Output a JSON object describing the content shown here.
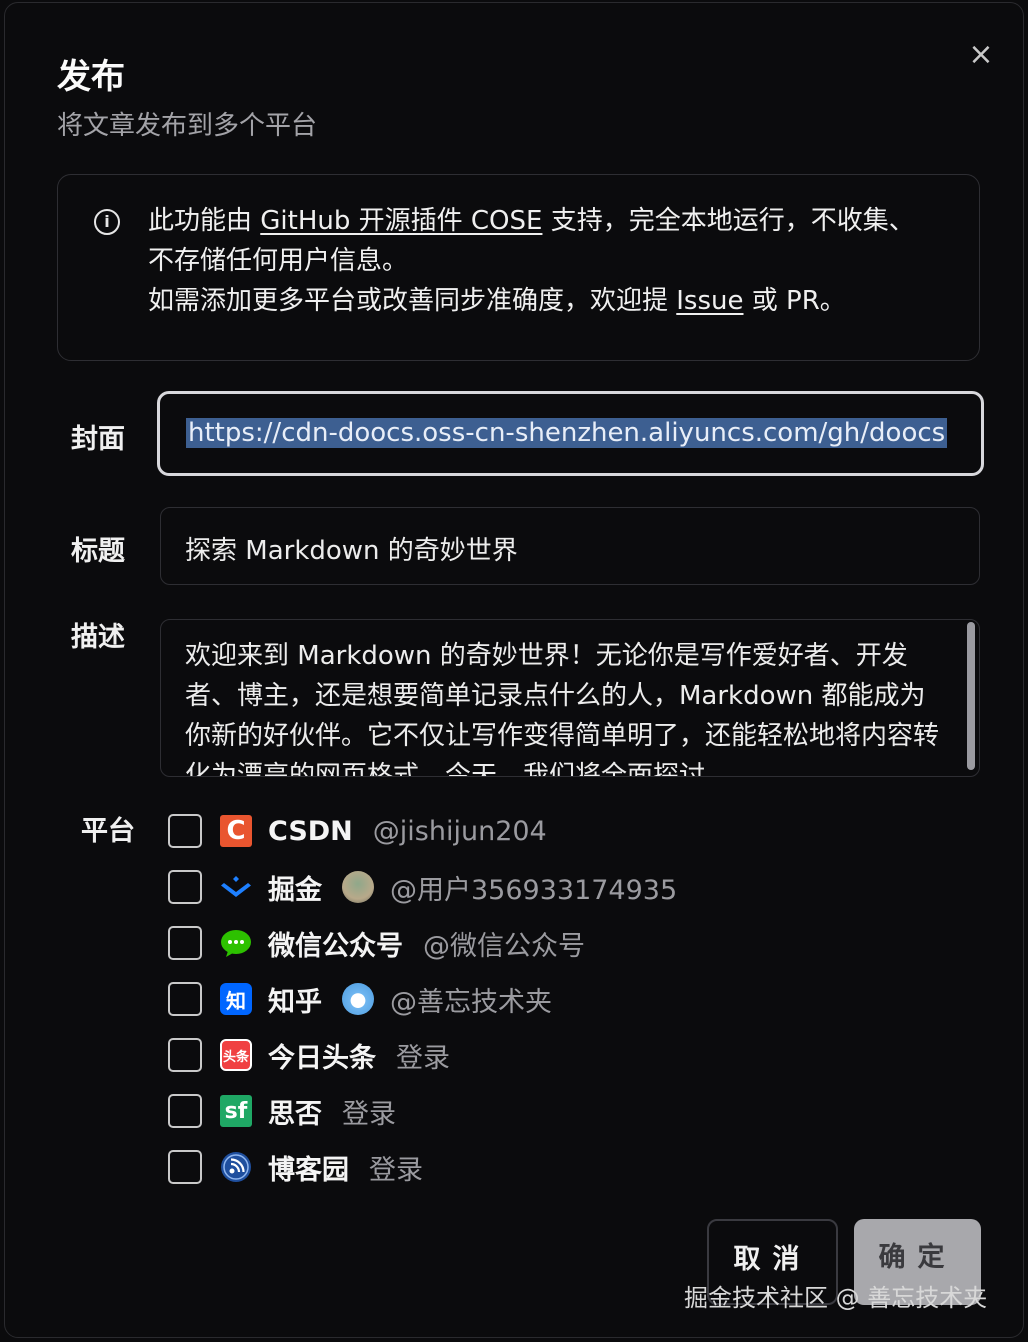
{
  "dialog": {
    "title": "发布",
    "subtitle": "将文章发布到多个平台",
    "close_symbol": "×"
  },
  "notice": {
    "icon": "info-icon",
    "part1": "此功能由 ",
    "link1": "GitHub 开源插件 COSE",
    "part2": " 支持，完全本地运行，不收集、不存储任何用户信息。",
    "part3": "如需添加更多平台或改善同步准确度，欢迎提 ",
    "link2": "Issue",
    "part4": " 或 PR。"
  },
  "form": {
    "cover_label": "封面",
    "cover_value": "https://cdn-doocs.oss-cn-shenzhen.aliyuncs.com/gh/doocs",
    "title_label": "标题",
    "title_value": "探索 Markdown 的奇妙世界",
    "desc_label": "描述",
    "desc_value": "欢迎来到 Markdown 的奇妙世界！无论你是写作爱好者、开发者、博主，还是想要简单记录点什么的人，Markdown 都能成为你新的好伙伴。它不仅让写作变得简单明了，还能轻松地将内容转化为漂亮的网页格式。今天，我们将全面探讨"
  },
  "platforms": {
    "label": "平台",
    "items": [
      {
        "name": "CSDN",
        "account": "@jishijun204",
        "icon": "csdn-icon",
        "icon_glyph": "C",
        "color": "#e9552f"
      },
      {
        "name": "掘金",
        "account": "@用户356933174935",
        "icon": "juejin-icon",
        "color": "#1e80ff"
      },
      {
        "name": "微信公众号",
        "account": "@微信公众号",
        "icon": "wechat-icon",
        "color": "#2dc100"
      },
      {
        "name": "知乎",
        "account": "@善忘技术夹",
        "icon": "zhihu-icon",
        "icon_glyph": "知",
        "color": "#0066ff"
      },
      {
        "name": "今日头条",
        "login": "登录",
        "icon": "toutiao-icon",
        "icon_glyph": "头条",
        "color": "#f04142"
      },
      {
        "name": "思否",
        "login": "登录",
        "icon": "segmentfault-icon",
        "icon_glyph": "sf",
        "color": "#1fa865"
      },
      {
        "name": "博客园",
        "login": "登录",
        "icon": "cnblogs-icon",
        "color": "#2f6fd6"
      }
    ]
  },
  "buttons": {
    "cancel": "取消",
    "confirm": "确定"
  },
  "watermark": "掘金技术社区 @ 善忘技术夹"
}
